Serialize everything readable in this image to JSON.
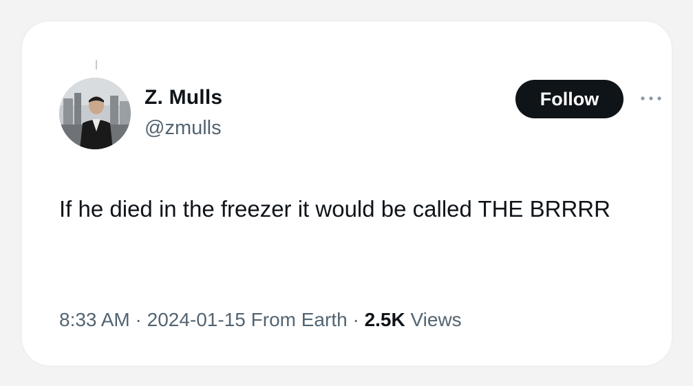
{
  "tweet": {
    "author": {
      "display_name": "Z. Mulls",
      "handle": "@zmulls",
      "avatar_icon": "profile-photo"
    },
    "follow_label": "Follow",
    "more_icon": "ellipsis-icon",
    "text": "If he died in the freezer it would be called THE BRRRR",
    "meta": {
      "time": "8:33 AM",
      "separator": " · ",
      "date": "2024-01-15",
      "source": "From Earth",
      "views_count": "2.5K",
      "views_label": "Views"
    }
  },
  "colors": {
    "background": "#f3f3f3",
    "card": "#ffffff",
    "primary_text": "#0f1419",
    "secondary_text": "#536471",
    "follow_button_bg": "#0f1419",
    "follow_button_text": "#ffffff"
  }
}
